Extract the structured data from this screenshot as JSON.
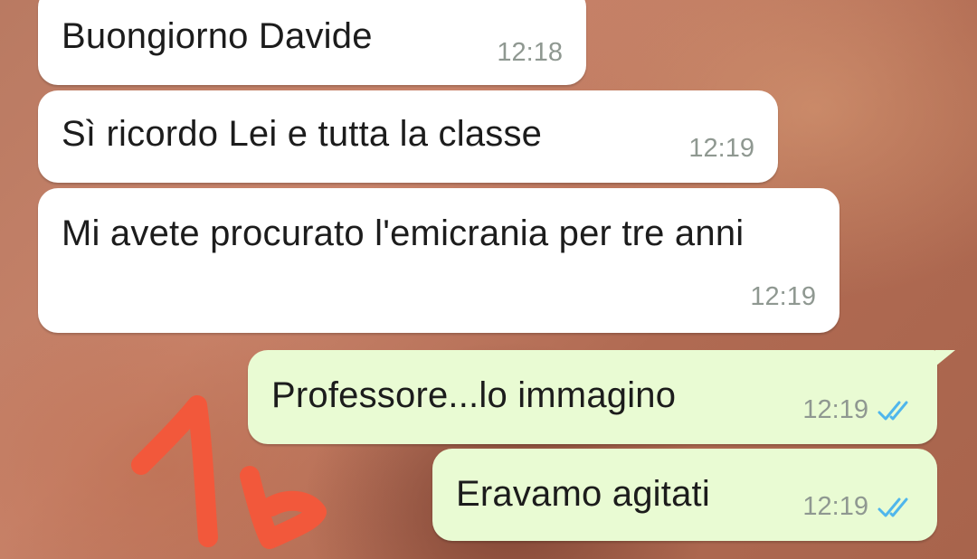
{
  "messages": [
    {
      "text": "Buongiorno Davide",
      "time": "12:18",
      "direction": "incoming"
    },
    {
      "text": "Sì ricordo Lei e tutta la classe",
      "time": "12:19",
      "direction": "incoming"
    },
    {
      "text": "Mi avete procurato l'emicrania per tre anni",
      "time": "12:19",
      "direction": "incoming"
    },
    {
      "text": "Professore...lo immagino",
      "time": "12:19",
      "direction": "outgoing",
      "status": "read-double-check-icon"
    },
    {
      "text": "Eravamo agitati",
      "time": "12:19",
      "direction": "outgoing",
      "status": "read-double-check-icon"
    }
  ],
  "annotation": {
    "text": "1b",
    "color": "#f2583b"
  },
  "colors": {
    "incoming_bubble": "#ffffff",
    "outgoing_bubble": "#e9fbd3",
    "time_text": "#8f9891",
    "read_ticks": "#4fb6ec"
  }
}
